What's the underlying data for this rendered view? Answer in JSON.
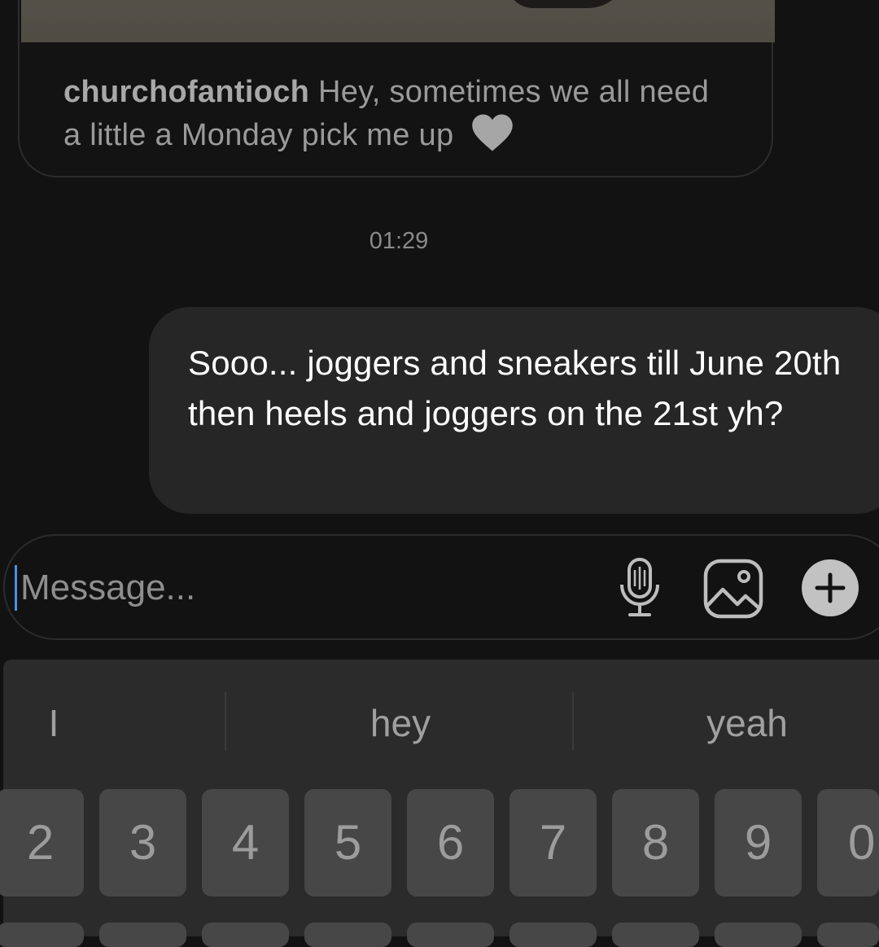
{
  "post": {
    "author": "churchofantioch",
    "caption": "Hey, sometimes we all need a little a Monday pick me up"
  },
  "timestamp": "01:29",
  "message": {
    "text": "Sooo... joggers and sneakers till June 20th then heels and joggers on the 21st yh?"
  },
  "composer": {
    "placeholder": "Message..."
  },
  "keyboard": {
    "suggestions": [
      "I",
      "hey",
      "yeah"
    ],
    "number_keys": [
      "2",
      "3",
      "4",
      "5",
      "6",
      "7",
      "8",
      "9",
      "0"
    ]
  },
  "colors": {
    "background": "#121212",
    "bubble": "#262626",
    "keyboard": "#2b2b2b",
    "key": "#474747",
    "cursor": "#4a90e2"
  },
  "icons": [
    "heart-icon",
    "microphone-icon",
    "gallery-icon",
    "plus-icon"
  ]
}
